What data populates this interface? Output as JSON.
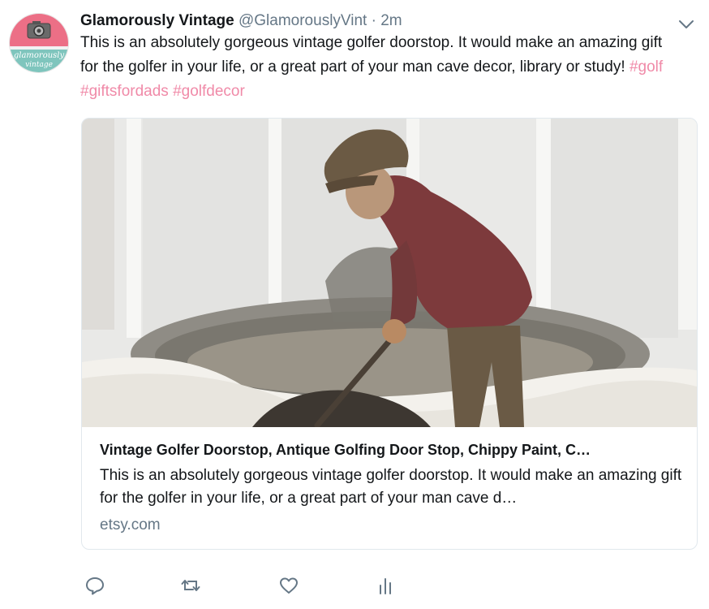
{
  "tweet": {
    "author_name": "Glamorously Vintage",
    "handle": "@GlamorouslyVint",
    "separator": "·",
    "time": "2m",
    "text": "This is an absolutely gorgeous vintage golfer doorstop. It would make an amazing gift for the golfer in your life, or a great part of your man cave decor, library or study!",
    "hashtags": [
      "#golf",
      "#giftsfordads",
      "#golfdecor"
    ],
    "avatar": {
      "text_line1": "glamorously",
      "text_line2": "vintage"
    }
  },
  "card": {
    "title": "Vintage Golfer Doorstop, Antique Golfing Door Stop, Chippy Paint, C…",
    "description": "This is an absolutely gorgeous vintage golfer doorstop. It would make an amazing gift for the golfer in your life, or a great part of your man cave d…",
    "domain": "etsy.com"
  },
  "actions": [
    "reply-icon",
    "retweet-icon",
    "like-icon",
    "analytics-icon"
  ],
  "colors": {
    "hashtag": "#f08aa8",
    "muted": "#657786",
    "text": "#14171a",
    "border": "#e1e8ed"
  }
}
